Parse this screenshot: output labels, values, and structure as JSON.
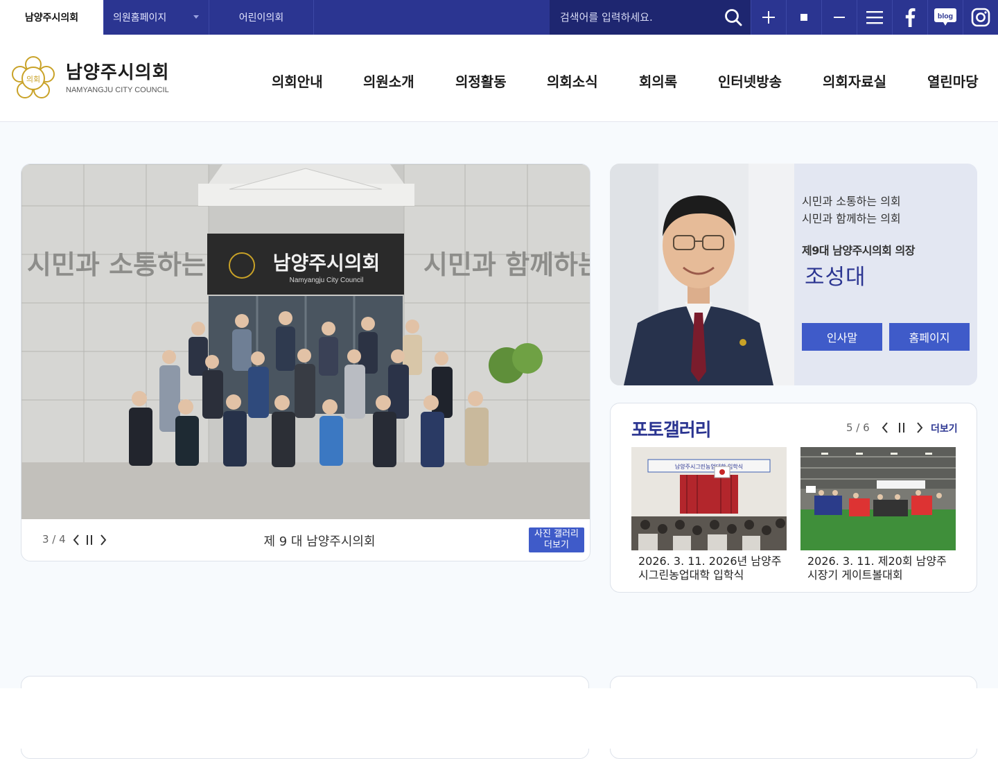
{
  "topbar": {
    "tabs": [
      {
        "label": "남양주시의회"
      },
      {
        "label": "의원홈페이지"
      },
      {
        "label": "어린이의회"
      }
    ],
    "search": {
      "placeholder": "검색어를 입력하세요."
    },
    "tools": [
      "zoom-in-icon",
      "zoom-reset-icon",
      "zoom-out-icon",
      "menu-icon",
      "facebook-icon",
      "blog-icon",
      "instagram-icon"
    ],
    "blog_label": "blog",
    "color": "#2b3591"
  },
  "header": {
    "logo_title": "남양주시의회",
    "logo_sub": "NAMYANGJU CITY COUNCIL",
    "logo_emblem_text": "의회",
    "nav": [
      "의회안내",
      "의원소개",
      "의정활동",
      "의회소식",
      "회의록",
      "인터넷방송",
      "의회자료실",
      "열린마당"
    ]
  },
  "visual": {
    "counter": "3 / 4",
    "caption": "제 9 대 남양주시의회",
    "more_label_1": "사진 갤러리",
    "more_label_2": "더보기",
    "sign_title": "남양주시의회",
    "sign_sub": "Namyangju City Council",
    "wall_left": "시민과 소통하는",
    "wall_right": "시민과 함께하는"
  },
  "chair": {
    "slogan_1": "시민과 소통하는 의회",
    "slogan_2": "시민과 함께하는 의회",
    "role": "제9대 남양주시의회 의장",
    "name": "조성대",
    "greeting_label": "인사말",
    "homepage_label": "홈페이지"
  },
  "gallery": {
    "title": "포토갤러리",
    "counter": "5 / 6",
    "more_label": "더보기",
    "items": [
      {
        "caption": "2026. 3. 11. 2026년 남양주시그린농업대학 입학식",
        "banner": "남양주시그린농업대학 입학식"
      },
      {
        "caption": "2026. 3. 11. 제20회 남양주시장기 게이트볼대회"
      }
    ]
  },
  "colors": {
    "accent": "#2b3591",
    "button": "#3f5bc9",
    "background": "#f7fafd"
  }
}
